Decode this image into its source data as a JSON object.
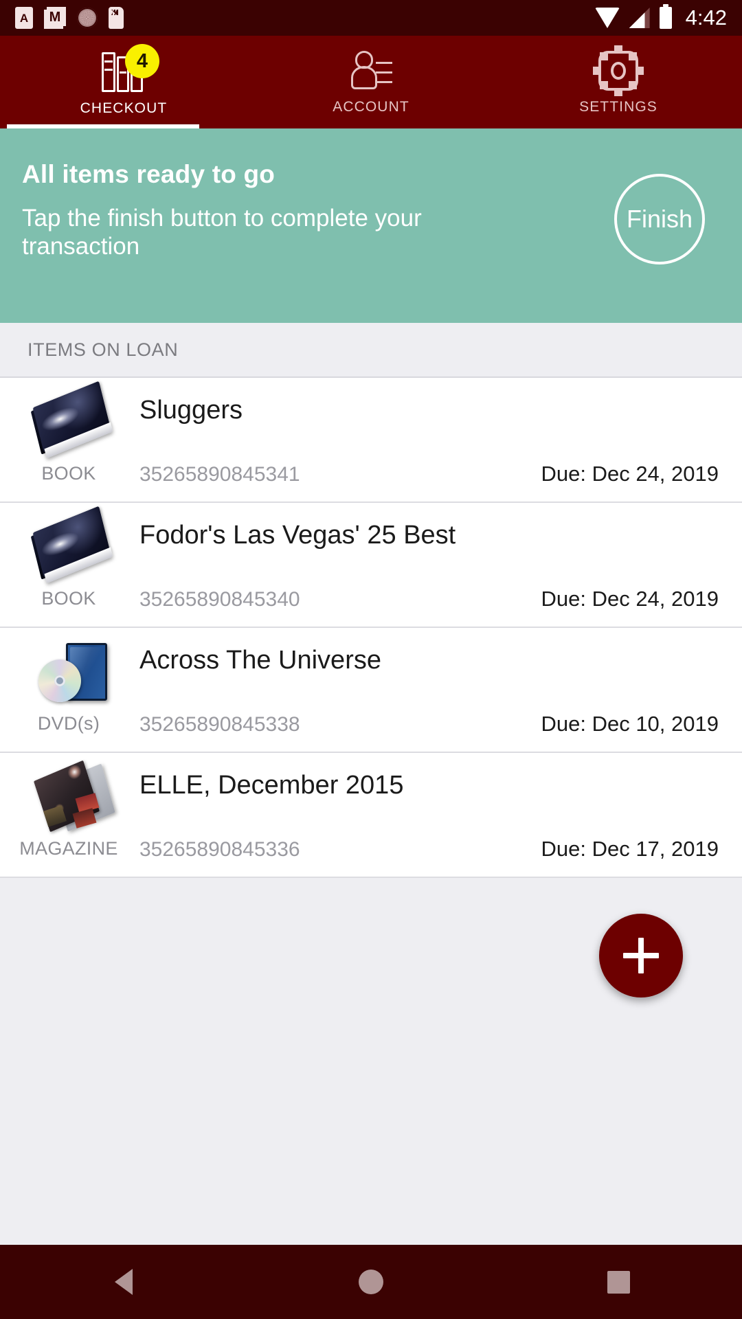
{
  "status_bar": {
    "time": "4:42",
    "left_icons": [
      "authenticator-icon",
      "gmail-icon",
      "disc-icon",
      "sd-card-icon"
    ],
    "right_icons": [
      "wifi-icon",
      "cell-signal-icon",
      "battery-icon"
    ],
    "background_color": "#3b0202"
  },
  "tabs": {
    "active_index": 0,
    "items": [
      {
        "label": "CHECKOUT",
        "icon": "books-icon",
        "badge": "4"
      },
      {
        "label": "ACCOUNT",
        "icon": "account-icon",
        "badge": ""
      },
      {
        "label": "SETTINGS",
        "icon": "gear-icon",
        "badge": ""
      }
    ],
    "background_color": "#6d0000",
    "badge_color": "#f9f000"
  },
  "banner": {
    "title": "All items ready to go",
    "subtitle": "Tap the finish button to complete your transaction",
    "finish_label": "Finish",
    "background_color": "#7fbfae"
  },
  "section": {
    "header": "ITEMS ON LOAN"
  },
  "items": [
    {
      "title": "Sluggers",
      "type": "BOOK",
      "icon": "book-icon",
      "barcode": "35265890845341",
      "due": "Due: Dec 24, 2019"
    },
    {
      "title": "Fodor's Las Vegas' 25 Best",
      "type": "BOOK",
      "icon": "book-icon",
      "barcode": "35265890845340",
      "due": "Due: Dec 24, 2019"
    },
    {
      "title": "Across The Universe",
      "type": "DVD(s)",
      "icon": "dvd-icon",
      "barcode": "35265890845338",
      "due": "Due: Dec 10, 2019"
    },
    {
      "title": "ELLE, December 2015",
      "type": "MAGAZINE",
      "icon": "magazine-icon",
      "barcode": "35265890845336",
      "due": "Due: Dec 17, 2019"
    }
  ],
  "fab": {
    "icon": "plus-icon",
    "color": "#6d0000"
  },
  "nav_bar": {
    "buttons": [
      "back-icon",
      "home-icon",
      "recents-icon"
    ],
    "background_color": "#3b0202"
  }
}
